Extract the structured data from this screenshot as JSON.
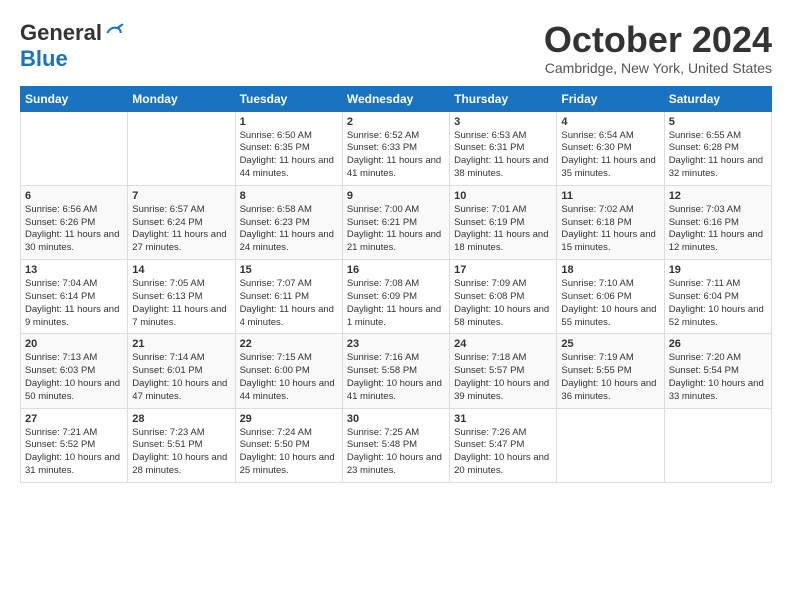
{
  "logo": {
    "general": "General",
    "blue": "Blue"
  },
  "header": {
    "title": "October 2024",
    "subtitle": "Cambridge, New York, United States"
  },
  "weekdays": [
    "Sunday",
    "Monday",
    "Tuesday",
    "Wednesday",
    "Thursday",
    "Friday",
    "Saturday"
  ],
  "weeks": [
    [
      {
        "day": "",
        "info": ""
      },
      {
        "day": "",
        "info": ""
      },
      {
        "day": "1",
        "info": "Sunrise: 6:50 AM\nSunset: 6:35 PM\nDaylight: 11 hours and 44 minutes."
      },
      {
        "day": "2",
        "info": "Sunrise: 6:52 AM\nSunset: 6:33 PM\nDaylight: 11 hours and 41 minutes."
      },
      {
        "day": "3",
        "info": "Sunrise: 6:53 AM\nSunset: 6:31 PM\nDaylight: 11 hours and 38 minutes."
      },
      {
        "day": "4",
        "info": "Sunrise: 6:54 AM\nSunset: 6:30 PM\nDaylight: 11 hours and 35 minutes."
      },
      {
        "day": "5",
        "info": "Sunrise: 6:55 AM\nSunset: 6:28 PM\nDaylight: 11 hours and 32 minutes."
      }
    ],
    [
      {
        "day": "6",
        "info": "Sunrise: 6:56 AM\nSunset: 6:26 PM\nDaylight: 11 hours and 30 minutes."
      },
      {
        "day": "7",
        "info": "Sunrise: 6:57 AM\nSunset: 6:24 PM\nDaylight: 11 hours and 27 minutes."
      },
      {
        "day": "8",
        "info": "Sunrise: 6:58 AM\nSunset: 6:23 PM\nDaylight: 11 hours and 24 minutes."
      },
      {
        "day": "9",
        "info": "Sunrise: 7:00 AM\nSunset: 6:21 PM\nDaylight: 11 hours and 21 minutes."
      },
      {
        "day": "10",
        "info": "Sunrise: 7:01 AM\nSunset: 6:19 PM\nDaylight: 11 hours and 18 minutes."
      },
      {
        "day": "11",
        "info": "Sunrise: 7:02 AM\nSunset: 6:18 PM\nDaylight: 11 hours and 15 minutes."
      },
      {
        "day": "12",
        "info": "Sunrise: 7:03 AM\nSunset: 6:16 PM\nDaylight: 11 hours and 12 minutes."
      }
    ],
    [
      {
        "day": "13",
        "info": "Sunrise: 7:04 AM\nSunset: 6:14 PM\nDaylight: 11 hours and 9 minutes."
      },
      {
        "day": "14",
        "info": "Sunrise: 7:05 AM\nSunset: 6:13 PM\nDaylight: 11 hours and 7 minutes."
      },
      {
        "day": "15",
        "info": "Sunrise: 7:07 AM\nSunset: 6:11 PM\nDaylight: 11 hours and 4 minutes."
      },
      {
        "day": "16",
        "info": "Sunrise: 7:08 AM\nSunset: 6:09 PM\nDaylight: 11 hours and 1 minute."
      },
      {
        "day": "17",
        "info": "Sunrise: 7:09 AM\nSunset: 6:08 PM\nDaylight: 10 hours and 58 minutes."
      },
      {
        "day": "18",
        "info": "Sunrise: 7:10 AM\nSunset: 6:06 PM\nDaylight: 10 hours and 55 minutes."
      },
      {
        "day": "19",
        "info": "Sunrise: 7:11 AM\nSunset: 6:04 PM\nDaylight: 10 hours and 52 minutes."
      }
    ],
    [
      {
        "day": "20",
        "info": "Sunrise: 7:13 AM\nSunset: 6:03 PM\nDaylight: 10 hours and 50 minutes."
      },
      {
        "day": "21",
        "info": "Sunrise: 7:14 AM\nSunset: 6:01 PM\nDaylight: 10 hours and 47 minutes."
      },
      {
        "day": "22",
        "info": "Sunrise: 7:15 AM\nSunset: 6:00 PM\nDaylight: 10 hours and 44 minutes."
      },
      {
        "day": "23",
        "info": "Sunrise: 7:16 AM\nSunset: 5:58 PM\nDaylight: 10 hours and 41 minutes."
      },
      {
        "day": "24",
        "info": "Sunrise: 7:18 AM\nSunset: 5:57 PM\nDaylight: 10 hours and 39 minutes."
      },
      {
        "day": "25",
        "info": "Sunrise: 7:19 AM\nSunset: 5:55 PM\nDaylight: 10 hours and 36 minutes."
      },
      {
        "day": "26",
        "info": "Sunrise: 7:20 AM\nSunset: 5:54 PM\nDaylight: 10 hours and 33 minutes."
      }
    ],
    [
      {
        "day": "27",
        "info": "Sunrise: 7:21 AM\nSunset: 5:52 PM\nDaylight: 10 hours and 31 minutes."
      },
      {
        "day": "28",
        "info": "Sunrise: 7:23 AM\nSunset: 5:51 PM\nDaylight: 10 hours and 28 minutes."
      },
      {
        "day": "29",
        "info": "Sunrise: 7:24 AM\nSunset: 5:50 PM\nDaylight: 10 hours and 25 minutes."
      },
      {
        "day": "30",
        "info": "Sunrise: 7:25 AM\nSunset: 5:48 PM\nDaylight: 10 hours and 23 minutes."
      },
      {
        "day": "31",
        "info": "Sunrise: 7:26 AM\nSunset: 5:47 PM\nDaylight: 10 hours and 20 minutes."
      },
      {
        "day": "",
        "info": ""
      },
      {
        "day": "",
        "info": ""
      }
    ]
  ]
}
